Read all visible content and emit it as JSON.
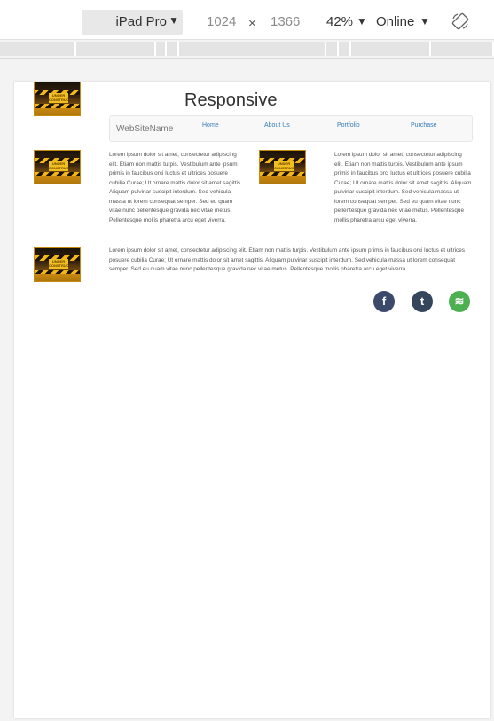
{
  "toolbar": {
    "device": "iPad Pro",
    "width": "1024",
    "times": "×",
    "height": "1366",
    "zoom": "42%",
    "throttling": "Online",
    "icons": {
      "dropdown": "caret-down-icon",
      "rotate": "rotate-icon"
    }
  },
  "site": {
    "title": "Responsive",
    "brand": "WebSiteName",
    "nav": [
      "Home",
      "About Us",
      "Portfolio",
      "Purchase"
    ],
    "image_caption": "UNDER CONSTRUCTION",
    "para_short": "Lorem ipsum dolor sit amet, consectetur adipiscing elit. Etiam non mattis turpis. Vestibulum ante ipsum primis in faucibus orci luctus et ultrices posuere cubilia Curae; Ut ornare mattis dolor sit amet sagittis. Aliquam pulvinar suscipit interdum. Sed vehicula massa ut lorem consequat semper. Sed eu quam vitae nunc pellentesque gravida nec vitae metus. Pellentesque mollis pharetra arcu eget viverra.",
    "para_long": "Lorem ipsum dolor sit amet, consectetur adipiscing elit. Etiam non mattis turpis. Vestibulum ante ipsum primis in faucibus orci luctus et ultrices posuere cubilia Curae; Ut ornare mattis dolor sit amet sagittis. Aliquam pulvinar suscipit interdum. Sed vehicula massa ut lorem consequat semper. Sed eu quam vitae nunc pellentesque gravida nec vitae metus. Pellentesque mollis pharetra arcu eget viverra.",
    "social": [
      {
        "name": "facebook-icon",
        "glyph": "f",
        "color": "#3b4a6b"
      },
      {
        "name": "tumblr-icon",
        "glyph": "t",
        "color": "#35465c"
      },
      {
        "name": "spotify-icon",
        "glyph": "≋",
        "color": "#4caf50"
      }
    ]
  }
}
